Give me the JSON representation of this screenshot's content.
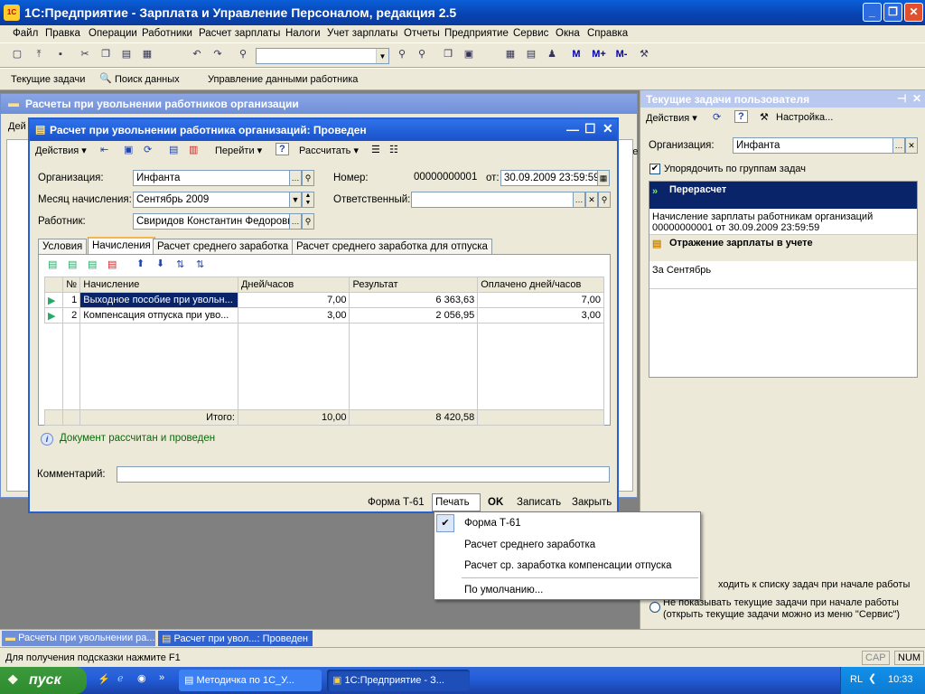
{
  "app": {
    "title": "1С:Предприятие - Зарплата и Управление Персоналом, редакция 2.5",
    "logo": "1C v8"
  },
  "menu": [
    "Файл",
    "Правка",
    "Операции",
    "Работники",
    "Расчет зарплаты",
    "Налоги",
    "Учет зарплаты",
    "Отчеты",
    "Предприятие",
    "Сервис",
    "Окна",
    "Справка"
  ],
  "toolbar2": {
    "current_tasks": "Текущие задачи",
    "search": "Поиск данных",
    "manage": "Управление данными работника"
  },
  "toolbar1": {
    "m": "M",
    "mplus": "M+",
    "mminus": "M-"
  },
  "bgwindow": {
    "title": "Расчеты при увольнении работников организации",
    "actions": "Дей",
    "right_clip": "имме"
  },
  "dialog": {
    "title": "Расчет при увольнении работника организаций: Проведен",
    "toolbar": {
      "actions": "Действия",
      "goto": "Перейти",
      "calc": "Рассчитать"
    },
    "org_label": "Организация:",
    "org_value": "Инфанта",
    "month_label": "Месяц начисления:",
    "month_value": "Сентябрь 2009",
    "employee_label": "Работник:",
    "employee_value": "Свиридов Константин Федорович",
    "number_label": "Номер:",
    "number_value": "00000000001",
    "date_label": "от:",
    "date_value": "30.09.2009 23:59:59",
    "responsible_label": "Ответственный:",
    "tabs": [
      "Условия",
      "Начисления",
      "Расчет среднего заработка",
      "Расчет среднего заработка для отпуска"
    ],
    "grid": {
      "headers": [
        "№",
        "Начисление",
        "Дней/часов",
        "Результат",
        "Оплачено дней/часов"
      ],
      "rows": [
        {
          "n": "1",
          "name": "Выходное пособие при увольн...",
          "days": "7,00",
          "result": "6 363,63",
          "paid": "7,00"
        },
        {
          "n": "2",
          "name": "Компенсация отпуска при уво...",
          "days": "3,00",
          "result": "2 056,95",
          "paid": "3,00"
        }
      ],
      "total_label": "Итого:",
      "total_days": "10,00",
      "total_result": "8 420,58"
    },
    "info": "Документ рассчитан и проведен",
    "comment_label": "Комментарий:",
    "bottom": {
      "form": "Форма Т-61",
      "print": "Печать",
      "ok": "OK",
      "save": "Записать",
      "close": "Закрыть"
    }
  },
  "popup": {
    "items": [
      "Форма Т-61",
      "Расчет среднего заработка",
      "Расчет ср. заработка компенсации отпуска",
      "По умолчанию..."
    ]
  },
  "rightpanel": {
    "title": "Текущие задачи пользователя",
    "actions": "Действия",
    "settings": "Настройка...",
    "org_label": "Организация:",
    "org_value": "Инфанта",
    "group_check": "Упорядочить по группам задач",
    "group1": "Перерасчет",
    "task1_line1": "Начисление зарплаты работникам организаций",
    "task1_line2": "00000000001 от 30.09.2009 23:59:59",
    "group2": "Отражение зарплаты в учете",
    "task2": "За Сентябрь",
    "radio1": "ходить к списку задач при начале работы",
    "radio2_line1": "Не показывать текущие задачи при начале работы",
    "radio2_line2": "(открыть текущие задачи можно из меню \"Сервис\")"
  },
  "windows": [
    "Расчеты при увольнении ра...",
    "Расчет при увол...: Проведен"
  ],
  "status": {
    "hint": "Для получения подсказки нажмите F1",
    "cap": "CAP",
    "num": "NUM"
  },
  "taskbar": {
    "start": "пуск",
    "items": [
      "Методичка по 1С_У...",
      "1С:Предприятие - З..."
    ],
    "lang": "RL",
    "time": "10:33"
  }
}
